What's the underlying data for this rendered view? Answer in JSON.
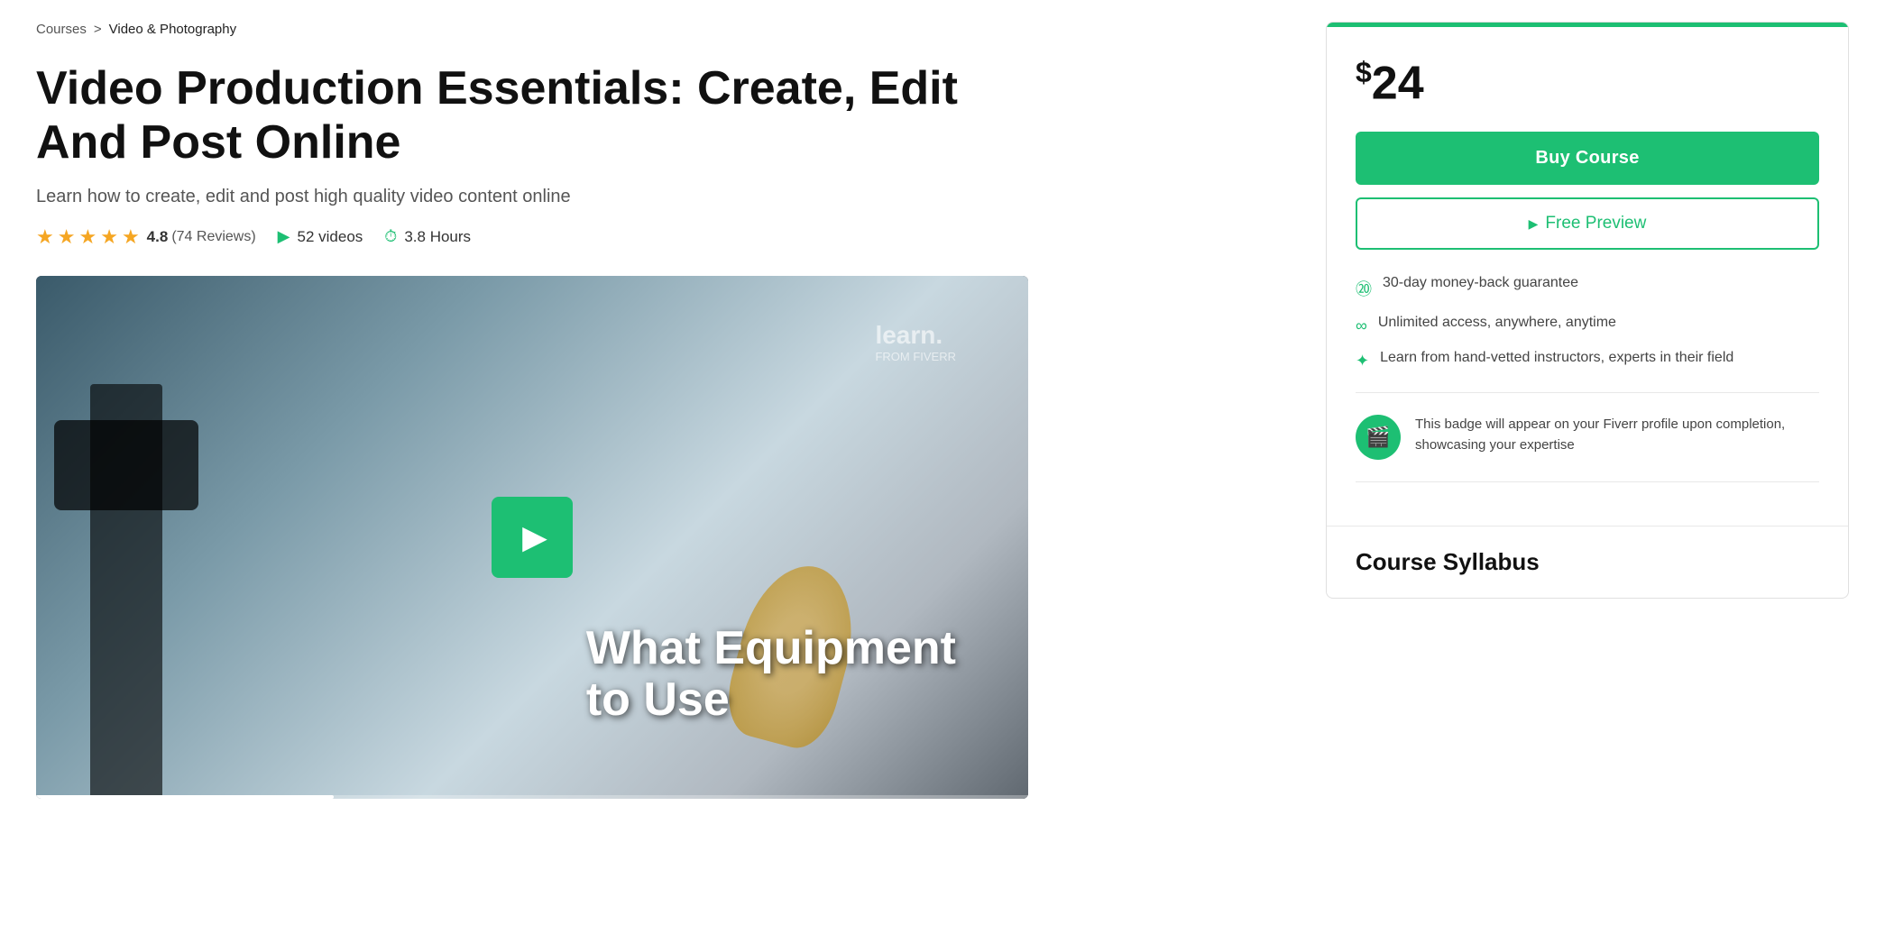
{
  "breadcrumb": {
    "courses_label": "Courses",
    "separator": ">",
    "category": "Video & Photography"
  },
  "course": {
    "title": "Video Production Essentials: Create, Edit And Post Online",
    "subtitle": "Learn how to create, edit and post high quality video content online",
    "rating": {
      "value": "4.8",
      "reviews_count": "(74 Reviews)"
    },
    "videos_count": "52 videos",
    "hours": "3.8 Hours"
  },
  "video": {
    "overlay_line1": "What Equipment",
    "overlay_line2": "to Use",
    "watermark_line1": "learn.",
    "watermark_line2": "FROM FIVERR",
    "progress_percent": 30
  },
  "sidebar": {
    "price": "24",
    "price_currency": "$",
    "buy_button_label": "Buy Course",
    "preview_button_label": "Free Preview",
    "features": [
      {
        "icon": "30",
        "text": "30-day money-back guarantee"
      },
      {
        "icon": "∞",
        "text": "Unlimited access, anywhere, anytime"
      },
      {
        "icon": "✦",
        "text": "Learn from hand-vetted instructors, experts in their field"
      }
    ],
    "badge_text": "This badge will appear on your Fiverr profile upon completion, showcasing your expertise",
    "syllabus_title": "Course Syllabus"
  }
}
